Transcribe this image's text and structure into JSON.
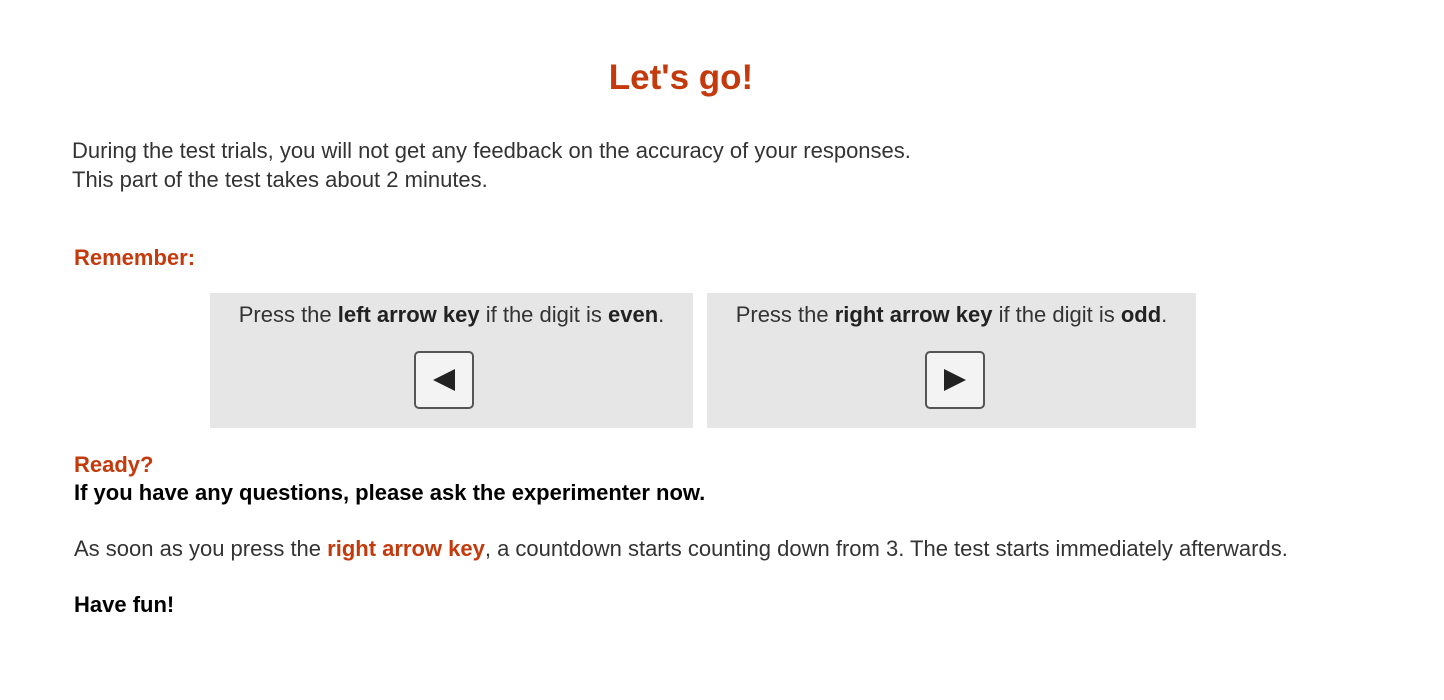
{
  "title": "Let's go!",
  "intro": {
    "line1": "During the test trials, you will not get any feedback on the accuracy of your responses.",
    "line2": "This part of the test takes about 2 minutes."
  },
  "remember_label": "Remember:",
  "panels": {
    "left": {
      "prefix": "Press the ",
      "key_name": "left arrow key",
      "middle": " if the digit is ",
      "parity": "even",
      "suffix": ".",
      "icon": "left-arrow-key-icon"
    },
    "right": {
      "prefix": "Press the ",
      "key_name": "right arrow key",
      "middle": " if the digit is ",
      "parity": "odd",
      "suffix": ".",
      "icon": "right-arrow-key-icon"
    }
  },
  "ready_label": "Ready?",
  "questions_text": "If you have any questions, please ask the experimenter now.",
  "countdown": {
    "prefix": "As soon as you press the ",
    "key_name": "right arrow key",
    "suffix": ", a countdown starts counting down from 3. The test starts immediately afterwards."
  },
  "closing": "Have fun!",
  "colors": {
    "accent": "#c43a0c",
    "panel_background": "#e6e6e6",
    "text": "#333333"
  }
}
